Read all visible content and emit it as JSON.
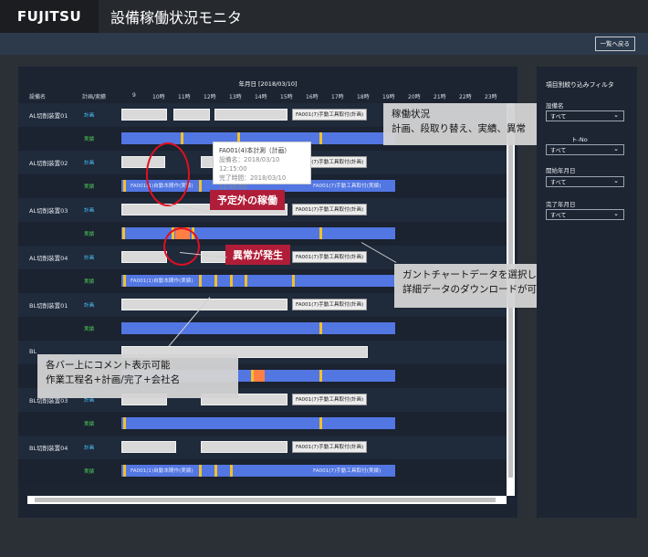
{
  "app": {
    "logo": "FUJITSU",
    "title": "設備稼働状況モニタ",
    "back_button": "一覧へ戻る"
  },
  "chart": {
    "month_label": "年月日 [2018/03/10]",
    "col_device": "設備名",
    "col_kind": "計画/実績",
    "hours": [
      "9",
      "10時",
      "11時",
      "12時",
      "13時",
      "14時",
      "15時",
      "16時",
      "17時",
      "18時",
      "19時",
      "20時",
      "21時",
      "22時",
      "23時"
    ],
    "plan_label": "計画",
    "actual_label": "実績",
    "devices": [
      "AL切削装置01",
      "AL切削装置02",
      "AL切削装置03",
      "AL切削装置04",
      "BL切削装置01",
      "BL",
      "BL切削装置03",
      "BL切削装置04"
    ],
    "bar_labels": {
      "plan_tag": "FA001(7)手動工具取付(計画)",
      "act_tag": "FA001(7)手動工具取付(実績)",
      "act_auto": "FA001(1)自動本間作(実績)"
    }
  },
  "tooltip": {
    "line1": "FA001(4)本計測（計画）",
    "line2": "設備名：2018/03/10 12:15:00",
    "line3": "完了時間：2018/03/10 12:40:00"
  },
  "callouts": {
    "status_title": "稼働状況",
    "status_body": "計画、段取り替え、実績、異常",
    "unplanned": "予定外の稼働",
    "abnormal": "異常が発生",
    "gantt_line1": "ガントチャートデータを選択し、",
    "gantt_line2": "詳細データのダウンロードが可能",
    "comment_line1": "各バー上にコメント表示可能",
    "comment_line2": "作業工程名+計画/完了+会社名"
  },
  "filter": {
    "title": "項目別絞り込みフィルタ",
    "label_device": "設備名",
    "label_lot": "ト-No",
    "label_start": "開始年月日",
    "label_end": "完了年月日",
    "all": "すべて"
  },
  "colors": {
    "plan_bar": "#d9d9d9",
    "actual_bar": "#5276e2",
    "changeover": "#f2c12c",
    "abnormal": "#ff7f45",
    "callout_red": "#b01d38"
  }
}
